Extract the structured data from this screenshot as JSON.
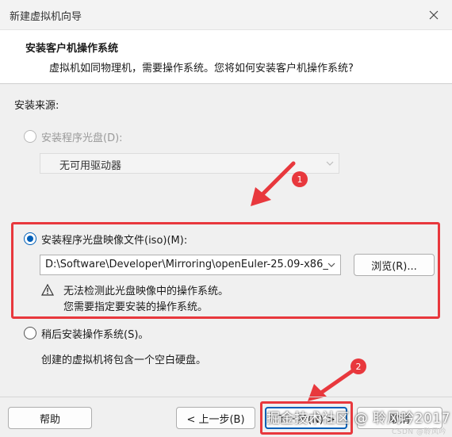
{
  "window": {
    "title": "新建虚拟机向导"
  },
  "header": {
    "title": "安装客户机操作系统",
    "subtitle": "虚拟机如同物理机，需要操作系统。您将如何安装客户机操作系统?"
  },
  "source_label": "安装来源:",
  "options": {
    "disc": {
      "label": "安装程序光盘(D):",
      "dropdown_value": "无可用驱动器"
    },
    "iso": {
      "label": "安装程序光盘映像文件(iso)(M):",
      "path_value": "D:\\Software\\Developer\\Mirroring\\openEuler-25.09-x86_",
      "browse_label": "浏览(R)...",
      "warning_line1": "无法检测此光盘映像中的操作系统。",
      "warning_line2": "您需要指定要安装的操作系统。"
    },
    "later": {
      "label": "稍后安装操作系统(S)。",
      "description": "创建的虚拟机将包含一个空白硬盘。"
    }
  },
  "buttons": {
    "help": "帮助",
    "back": "< 上一步(B)",
    "next": "下一步(N) >",
    "cancel": "取消"
  },
  "annotations": {
    "step1": "1",
    "step2": "2"
  },
  "watermark": {
    "main": "掘金技术社区 @ 聆风吟2017",
    "small": "CSDN @聆风吟"
  },
  "colors": {
    "accent": "#005fb8",
    "highlight": "#e8383d"
  }
}
